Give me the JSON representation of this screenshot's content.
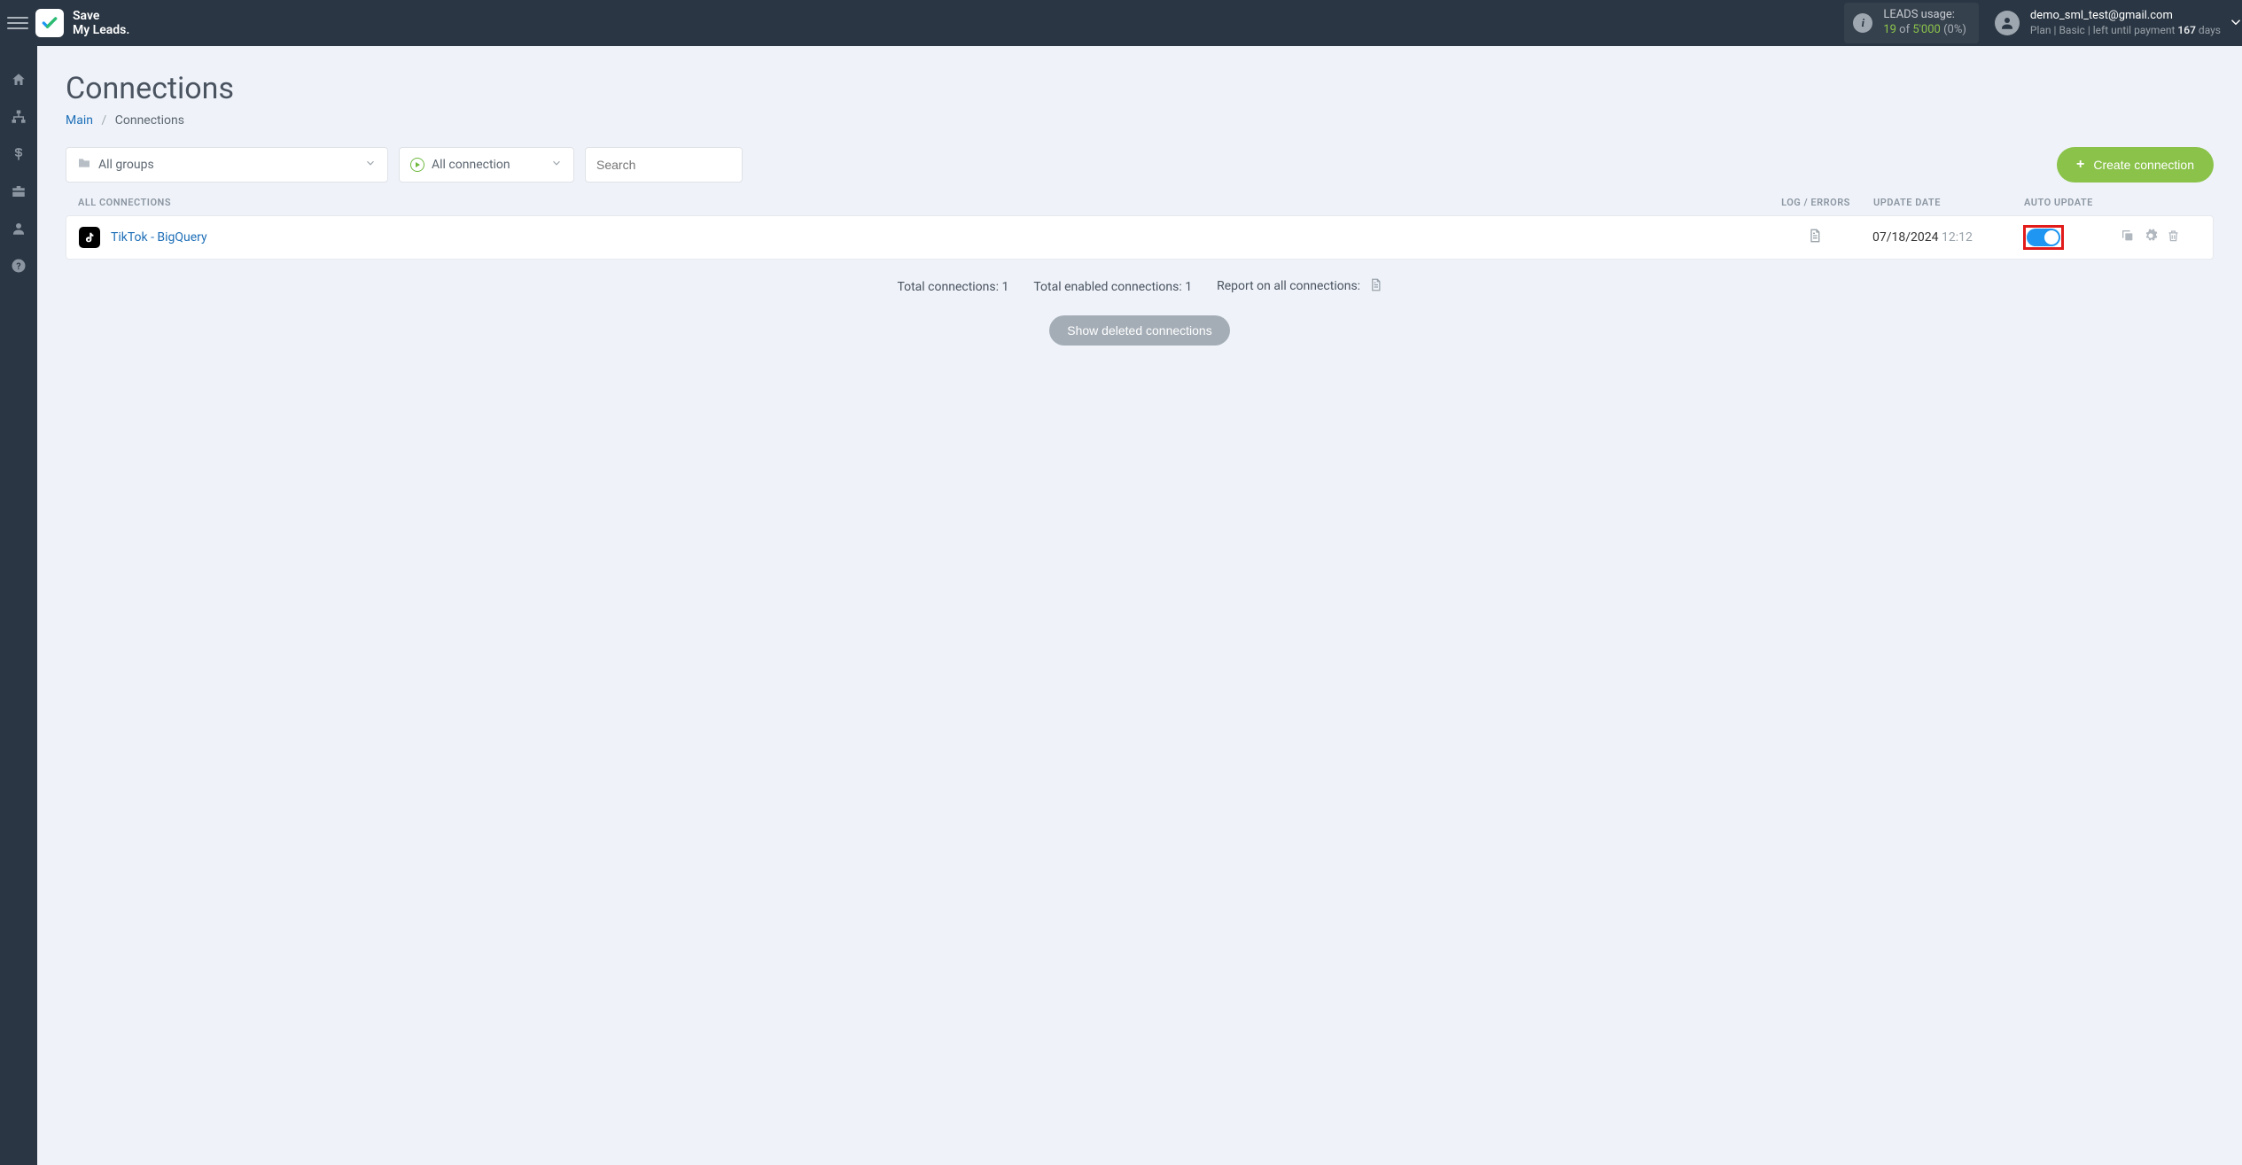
{
  "app": {
    "name_line1": "Save",
    "name_line2": "My Leads."
  },
  "header": {
    "leads_label": "LEADS usage:",
    "leads_used": "19",
    "leads_of": "of",
    "leads_total": "5'000",
    "leads_pct": "(0%)",
    "user_email": "demo_sml_test@gmail.com",
    "plan_prefix": "Plan |",
    "plan_name": "Basic",
    "plan_mid": "| left until payment",
    "plan_days": "167",
    "plan_suffix": "days"
  },
  "page": {
    "title": "Connections",
    "crumb_main": "Main",
    "crumb_current": "Connections"
  },
  "filters": {
    "groups": "All groups",
    "status": "All connection",
    "search_placeholder": "Search",
    "create_btn": "Create connection"
  },
  "table": {
    "col_name": "ALL CONNECTIONS",
    "col_log": "LOG / ERRORS",
    "col_date": "UPDATE DATE",
    "col_auto": "AUTO UPDATE"
  },
  "row": {
    "name": "TikTok - BigQuery",
    "date": "07/18/2024",
    "time": "12:12"
  },
  "summary": {
    "total": "Total connections: 1",
    "enabled": "Total enabled connections: 1",
    "report": "Report on all connections:",
    "show_deleted": "Show deleted connections"
  }
}
